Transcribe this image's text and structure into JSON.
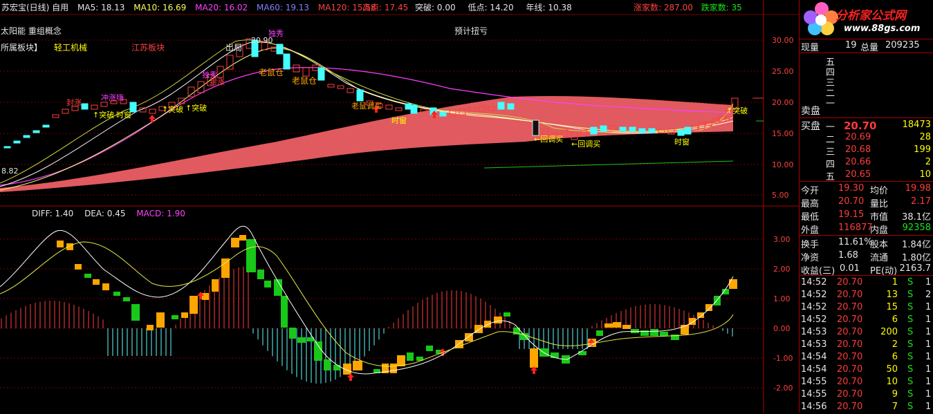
{
  "topbar": {
    "title": "苏宏宝(日线) 自用",
    "ma5": "MA5: 18.13",
    "ma10": "MA10: 16.69",
    "ma20": "MA20: 16.02",
    "ma60": "MA60: 19.13",
    "ma120": "MA120: 15.58",
    "high": "高点: 17.45",
    "break": "突破: 0.00",
    "low": "低点: 14.20",
    "yearline": "年线: 10.38",
    "up_count": "涨家数: 287.00",
    "down_count": "跌家数: 35"
  },
  "info": {
    "stock": "太阳能 重组概念",
    "sector_label": "所属板块】",
    "sector1": "轻工机械",
    "sector2": "江苏板块",
    "forecast": "预计扭亏"
  },
  "annotations": {
    "peak_price": "30.90",
    "left_value": "8.82",
    "chuju": "出局",
    "laoshucang1": "老鼠仓",
    "laoshucang2": "老鼠仓",
    "duxiu1": "独秀",
    "duxiu2": "独秀",
    "fengzhang1": "封涨",
    "fengzhang2": "封涨",
    "chongchao": "冲涨嗨",
    "tupo1": "↑突破",
    "tupo2": "↑突破",
    "tupo3": "↑突破",
    "tupo4": "↑突破",
    "shichuang1": "时窗",
    "shichuang2": "时窗",
    "shichuang3": "时窗",
    "laoshu_huitiao": "老鼠调买",
    "huitiao1": "←回调买",
    "huitiao2": "←回调买",
    "tupo_right": "↑突破"
  },
  "price_axis": [
    "30.00",
    "25.00",
    "20.00",
    "15.00",
    "10.00",
    "5.00"
  ],
  "macd_header": {
    "diff": "DIFF: 1.40",
    "dea": "DEA: 0.45",
    "macd": "MACD: 1.90"
  },
  "macd_axis": [
    "3.00",
    "2.00",
    "1.00",
    "0.00",
    "-1.00",
    "-2.00"
  ],
  "logo": {
    "brand": "分析家公式网",
    "url": "www.88gs.com"
  },
  "quote": {
    "xianliang_label": "现量",
    "xianliang": "19",
    "zongliang_label": "总量",
    "zongliang": "209235",
    "sell_levels": [
      "五",
      "四",
      "三",
      "二",
      "一"
    ],
    "sell_label": "卖盘",
    "buy_label": "买盘",
    "buy": [
      {
        "level": "一",
        "price": "20.70",
        "vol": "18473"
      },
      {
        "level": "二",
        "price": "20.69",
        "vol": "28"
      },
      {
        "level": "三",
        "price": "20.68",
        "vol": "199"
      },
      {
        "level": "四",
        "price": "20.66",
        "vol": "2"
      },
      {
        "level": "五",
        "price": "20.65",
        "vol": "10"
      }
    ],
    "stats": [
      {
        "l1": "今开",
        "v1": "19.30",
        "l2": "均价",
        "v2": "19.98"
      },
      {
        "l1": "最高",
        "v1": "20.70",
        "l2": "量比",
        "v2": "2.17"
      },
      {
        "l1": "最低",
        "v1": "19.15",
        "l2": "市值",
        "v2": "38.1亿"
      },
      {
        "l1": "外盘",
        "v1": "116877",
        "l2": "内盘",
        "v2": "92358"
      }
    ],
    "fin": [
      {
        "l1": "换手",
        "v1": "11.61%",
        "l2": "股本",
        "v2": "1.84亿"
      },
      {
        "l1": "净资",
        "v1": "1.68",
        "l2": "流通",
        "v2": "1.80亿"
      },
      {
        "l1": "收益(三)",
        "v1": "0.01",
        "l2": "PE(动)",
        "v2": "2163.7"
      }
    ],
    "ticks": [
      {
        "time": "14:52",
        "price": "20.70",
        "vol": "1",
        "side": "S",
        "n": "1"
      },
      {
        "time": "14:52",
        "price": "20.70",
        "vol": "13",
        "side": "S",
        "n": "2"
      },
      {
        "time": "14:52",
        "price": "20.70",
        "vol": "15",
        "side": "S",
        "n": "1"
      },
      {
        "time": "14:52",
        "price": "20.70",
        "vol": "6",
        "side": "S",
        "n": "1"
      },
      {
        "time": "14:53",
        "price": "20.70",
        "vol": "200",
        "side": "S",
        "n": "1"
      },
      {
        "time": "14:53",
        "price": "20.70",
        "vol": "2",
        "side": "S",
        "n": "1"
      },
      {
        "time": "14:54",
        "price": "20.70",
        "vol": "6",
        "side": "S",
        "n": "1"
      },
      {
        "time": "14:54",
        "price": "20.70",
        "vol": "50",
        "side": "S",
        "n": "1"
      },
      {
        "time": "14:55",
        "price": "20.70",
        "vol": "10",
        "side": "S",
        "n": "1"
      },
      {
        "time": "14:55",
        "price": "20.70",
        "vol": "9",
        "side": "S",
        "n": "1"
      },
      {
        "time": "14:56",
        "price": "20.70",
        "vol": "7",
        "side": "S",
        "n": "1"
      }
    ]
  },
  "colors": {
    "up_candle": "#ff4040",
    "down_candle": "#44ffff",
    "cloud": "#e05a5f",
    "macd_up": "#ffa500",
    "macd_down": "#19c819",
    "grid": "#a00000"
  }
}
